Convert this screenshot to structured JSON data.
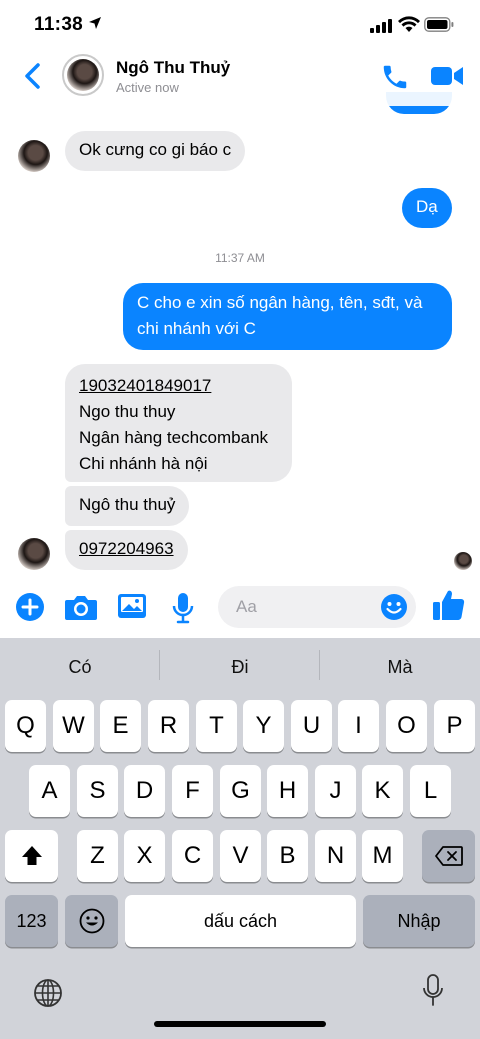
{
  "status_bar": {
    "time": "11:38"
  },
  "header": {
    "contact_name": "Ngô Thu Thuỷ",
    "contact_status": "Active now"
  },
  "messages": {
    "m1": "Ok cưng co gi báo c",
    "m2": "Dạ",
    "timestamp": "11:37 AM",
    "m3": "C cho e xin số ngân hàng, tên, sđt, và chi nhánh với C",
    "m4_line1": "19032401849017",
    "m4_line2": "Ngo thu thuy",
    "m4_line3": "Ngân hàng techcombank",
    "m4_line4": "Chi nhánh hà nội",
    "m5": "Ngô thu thuỷ",
    "m6": "0972204963"
  },
  "composer": {
    "placeholder": "Aa"
  },
  "keyboard": {
    "suggestions": [
      "Có",
      "Đi",
      "Mà"
    ],
    "row1": [
      "Q",
      "W",
      "E",
      "R",
      "T",
      "Y",
      "U",
      "I",
      "O",
      "P"
    ],
    "row2": [
      "A",
      "S",
      "D",
      "F",
      "G",
      "H",
      "J",
      "K",
      "L"
    ],
    "row3": [
      "Z",
      "X",
      "C",
      "V",
      "B",
      "N",
      "M"
    ],
    "numbers_label": "123",
    "space_label": "dấu cách",
    "return_label": "Nhập"
  },
  "colors": {
    "accent": "#0a84ff",
    "incoming_bubble": "#e9e9eb",
    "keyboard_bg": "#d1d3d9"
  }
}
